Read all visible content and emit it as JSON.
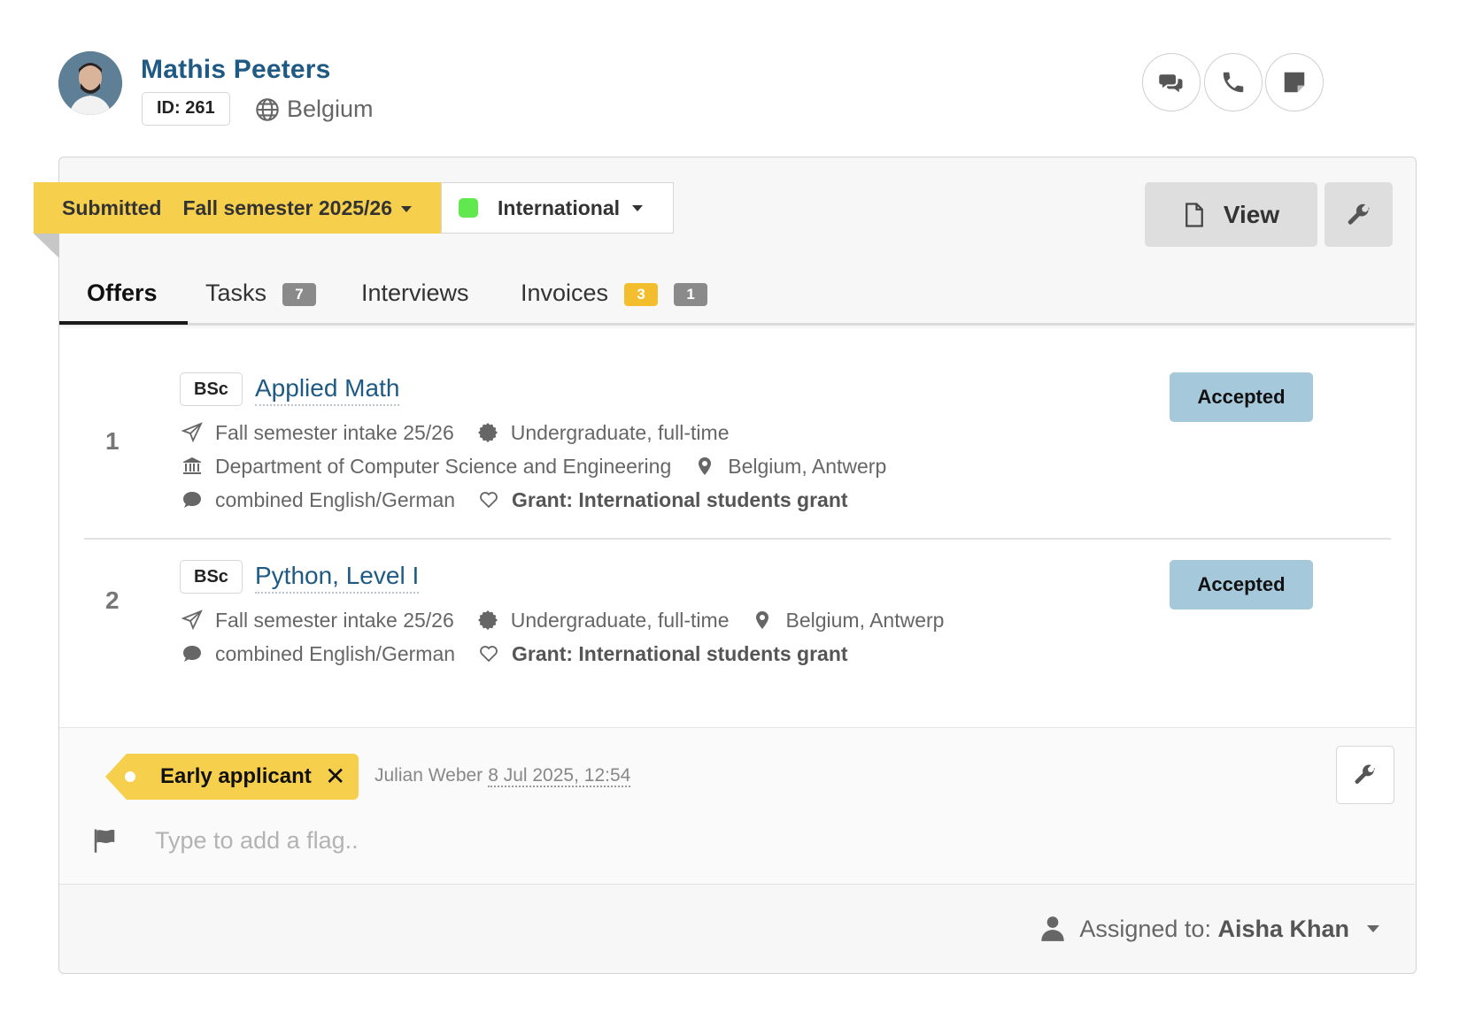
{
  "applicant": {
    "name": "Mathis Peeters",
    "id_label": "ID: 261",
    "country": "Belgium"
  },
  "status": {
    "label": "Submitted",
    "semester": "Fall semester 2025/26",
    "category": "International",
    "category_color": "#62e84f",
    "ribbon_color": "#f6cf4c"
  },
  "toolbar": {
    "view_label": "View"
  },
  "tabs": [
    {
      "label": "Offers"
    },
    {
      "label": "Tasks",
      "badge": "7"
    },
    {
      "label": "Interviews"
    },
    {
      "label": "Invoices",
      "badge": "3",
      "badge2": "1"
    }
  ],
  "offers": [
    {
      "number": "1",
      "degree": "BSc",
      "title": "Applied Math",
      "intake": "Fall semester intake 25/26",
      "level": "Undergraduate, full-time",
      "department": "Department of Computer Science and Engineering",
      "location": "Belgium, Antwerp",
      "language": "combined English/German",
      "grant": "Grant: International students grant",
      "status": "Accepted"
    },
    {
      "number": "2",
      "degree": "BSc",
      "title": "Python, Level I",
      "intake": "Fall semester intake 25/26",
      "level": "Undergraduate, full-time",
      "location": "Belgium, Antwerp",
      "language": "combined English/German",
      "grant": "Grant: International students grant",
      "status": "Accepted"
    }
  ],
  "flags": {
    "tag_label": "Early applicant",
    "tag_remove": "✕",
    "tag_author": "Julian Weber",
    "tag_date": "8 Jul 2025, 12:54",
    "input_placeholder": "Type to add a flag.."
  },
  "footer": {
    "assigned_prefix": "Assigned to:",
    "assigned_to": "Aisha Khan"
  },
  "colors": {
    "accent_link": "#1f5a84",
    "accepted_bg": "#a6c8db",
    "badge_yellow": "#f3be2e",
    "badge_gray": "#8a8a8a"
  }
}
